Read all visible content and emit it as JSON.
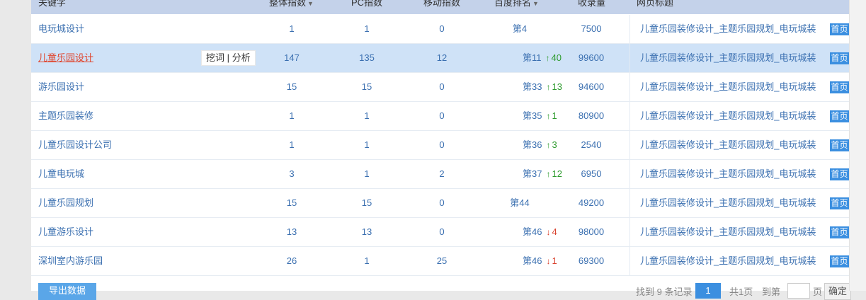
{
  "header": {
    "keyword": "关键字",
    "total_index": "整体指数",
    "pc_index": "PC指数",
    "mobile_index": "移动指数",
    "baidu_rank": "百度排名",
    "indexed": "收录量",
    "page_title": "网页标题"
  },
  "row_tools": {
    "dig": "挖词",
    "sep": "|",
    "analyze": "分析"
  },
  "rows": [
    {
      "keyword": "电玩城设计",
      "total": "1",
      "pc": "1",
      "mobile": "0",
      "rank": "第4",
      "change": "",
      "dir": "none",
      "indexed": "7500",
      "title": "儿童乐园装修设计_主题乐园规划_电玩城装",
      "home": "首页"
    },
    {
      "keyword": "儿童乐园设计",
      "total": "147",
      "pc": "135",
      "mobile": "12",
      "rank": "第11",
      "change": "40",
      "dir": "up",
      "indexed": "99600",
      "title": "儿童乐园装修设计_主题乐园规划_电玩城装",
      "home": "首页"
    },
    {
      "keyword": "游乐园设计",
      "total": "15",
      "pc": "15",
      "mobile": "0",
      "rank": "第33",
      "change": "13",
      "dir": "up",
      "indexed": "94600",
      "title": "儿童乐园装修设计_主题乐园规划_电玩城装",
      "home": "首页"
    },
    {
      "keyword": "主题乐园装修",
      "total": "1",
      "pc": "1",
      "mobile": "0",
      "rank": "第35",
      "change": "1",
      "dir": "up",
      "indexed": "80900",
      "title": "儿童乐园装修设计_主题乐园规划_电玩城装",
      "home": "首页"
    },
    {
      "keyword": "儿童乐园设计公司",
      "total": "1",
      "pc": "1",
      "mobile": "0",
      "rank": "第36",
      "change": "3",
      "dir": "up",
      "indexed": "2540",
      "title": "儿童乐园装修设计_主题乐园规划_电玩城装",
      "home": "首页"
    },
    {
      "keyword": "儿童电玩城",
      "total": "3",
      "pc": "1",
      "mobile": "2",
      "rank": "第37",
      "change": "12",
      "dir": "up",
      "indexed": "6950",
      "title": "儿童乐园装修设计_主题乐园规划_电玩城装",
      "home": "首页"
    },
    {
      "keyword": "儿童乐园规划",
      "total": "15",
      "pc": "15",
      "mobile": "0",
      "rank": "第44",
      "change": "",
      "dir": "none",
      "indexed": "49200",
      "title": "儿童乐园装修设计_主题乐园规划_电玩城装",
      "home": "首页"
    },
    {
      "keyword": "儿童游乐设计",
      "total": "13",
      "pc": "13",
      "mobile": "0",
      "rank": "第46",
      "change": "4",
      "dir": "down",
      "indexed": "98000",
      "title": "儿童乐园装修设计_主题乐园规划_电玩城装",
      "home": "首页"
    },
    {
      "keyword": "深圳室内游乐园",
      "total": "26",
      "pc": "1",
      "mobile": "25",
      "rank": "第46",
      "change": "1",
      "dir": "down",
      "indexed": "69300",
      "title": "儿童乐园装修设计_主题乐园规划_电玩城装",
      "home": "首页"
    }
  ],
  "footer": {
    "export": "导出数据",
    "found_prefix": "找到",
    "found_count": "9",
    "found_suffix": "条记录",
    "current_page": "1",
    "total_pages": "共1页",
    "goto": "到第",
    "page_unit": "页",
    "confirm": "确定"
  },
  "colors": {
    "accent": "#3b8fe0",
    "header_bg": "#c4d2ea",
    "up": "#2e9b2e",
    "down": "#d9432f",
    "highlight": "#cfe2f7"
  }
}
